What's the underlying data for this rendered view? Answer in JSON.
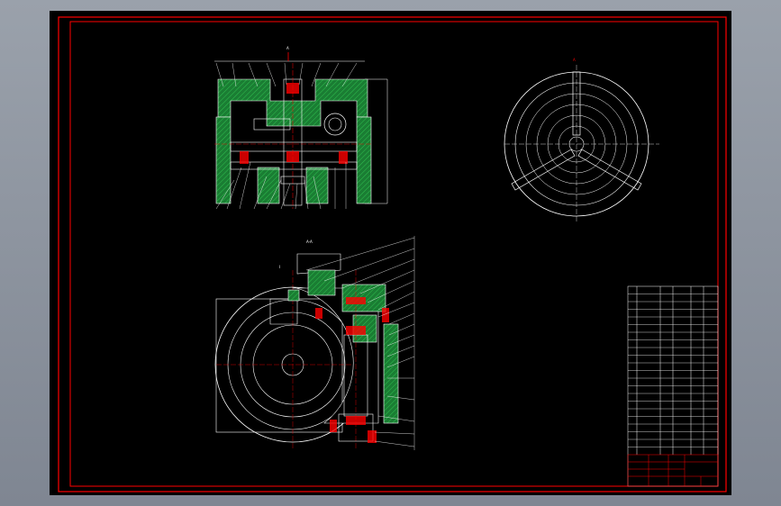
{
  "drawing": {
    "title": "",
    "sheet_color": "#000000",
    "frame_color": "#ff0000",
    "line_color": "#ffffff",
    "section_fill": "#1f8c3a",
    "accent_color": "#ff0000"
  },
  "views": {
    "top_view": {
      "name": ""
    },
    "plan_view": {
      "name": ""
    },
    "section_view": {
      "name": ""
    }
  },
  "title_block": {
    "rows": 22
  }
}
